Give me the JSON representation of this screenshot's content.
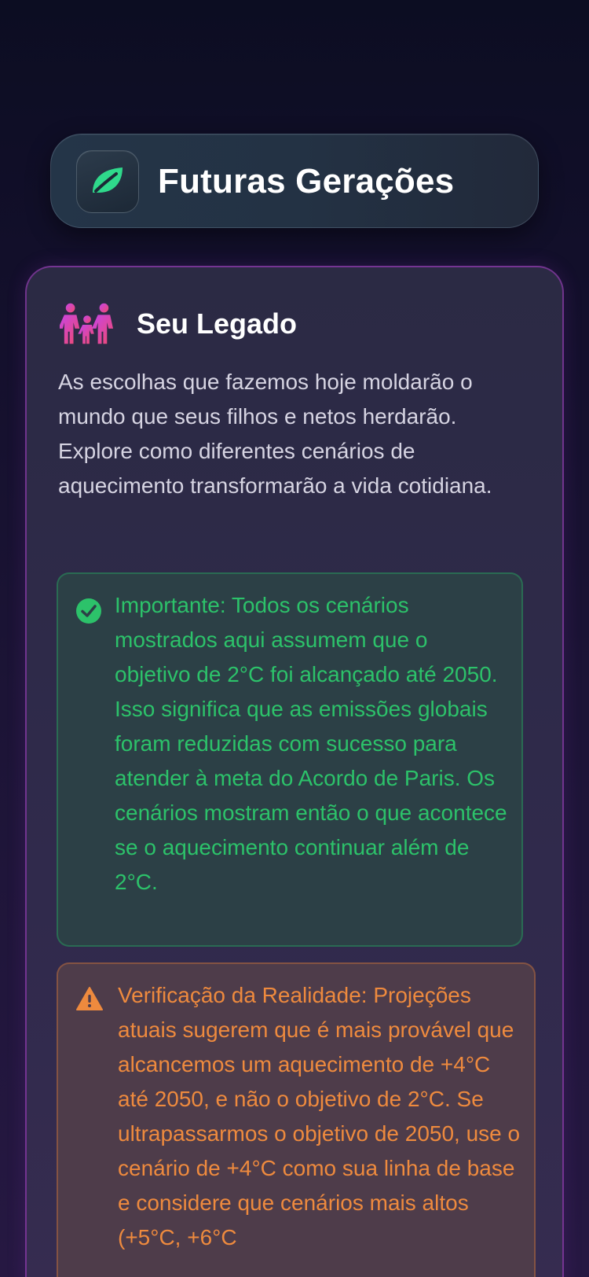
{
  "header": {
    "title": "Futuras Gerações",
    "icon": "leaf-icon",
    "accent": "#2fd98b"
  },
  "legacy": {
    "icon": "family-icon",
    "title": "Seu Legado",
    "description": "As escolhas que fazemos hoje moldarão o mundo que seus filhos e netos herdarão. Explore como diferentes cenários de aquecimento transformarão a vida cotidiana."
  },
  "notes": {
    "important": {
      "icon": "check-circle-icon",
      "color": "#2cc26a",
      "text": "Importante: Todos os cenários mostrados aqui assumem que o objetivo de 2°C foi alcançado até 2050. Isso significa que as emissões globais foram reduzidas com sucesso para atender à meta do Acordo de Paris. Os cenários mostram então o que acontece se o aquecimento continuar além de 2°C."
    },
    "reality": {
      "icon": "warning-icon",
      "color": "#ee8a3e",
      "text": "Verificação da Realidade: Projeções atuais sugerem que é mais provável que alcancemos um aquecimento de +4°C até 2050, e não o objetivo de 2°C. Se ultrapassarmos o objetivo de 2050, use o cenário de +4°C como sua linha de base e considere que cenários mais altos (+5°C, +6°C"
    }
  }
}
